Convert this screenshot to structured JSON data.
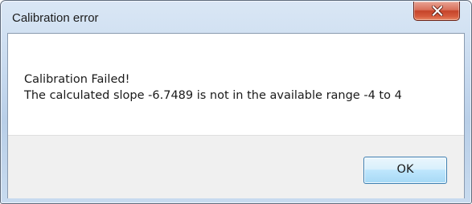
{
  "window": {
    "title": "Calibration error"
  },
  "message": {
    "line1": "Calibration Failed!",
    "line2": "The calculated slope -6.7489 is not in the available range -4 to 4"
  },
  "buttons": {
    "ok_label": "OK"
  },
  "icons": {
    "close": "close-icon"
  },
  "colors": {
    "close_button": "#c5442a",
    "ok_button_border": "#3c7fb1",
    "footer_background": "#f0f0f0"
  }
}
